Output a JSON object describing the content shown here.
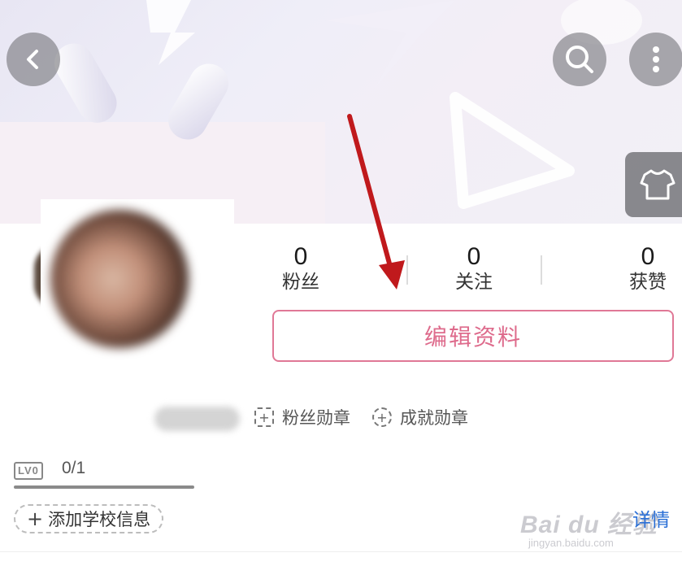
{
  "stats": [
    {
      "value": "0",
      "label": "粉丝"
    },
    {
      "value": "0",
      "label": "关注"
    },
    {
      "value": "0",
      "label": "获赞"
    }
  ],
  "edit_profile_label": "编辑资料",
  "badges": {
    "fan_badge": "粉丝勋章",
    "achievement_badge": "成就勋章"
  },
  "level": {
    "tag": "LV0",
    "progress_text": "0/1"
  },
  "school": {
    "plus": "+",
    "label": "添加学校信息"
  },
  "details_label": "详情",
  "watermark": {
    "brand": "Bai du 经验",
    "url": "jingyan.baidu.com"
  },
  "colors": {
    "accent": "#de6b8c",
    "link": "#2a6fd6",
    "annotation_arrow": "#c0191c"
  },
  "icons": [
    "back-arrow-icon",
    "search-icon",
    "more-dots-icon",
    "tshirt-icon",
    "fan-badge-icon",
    "achievement-badge-icon"
  ]
}
